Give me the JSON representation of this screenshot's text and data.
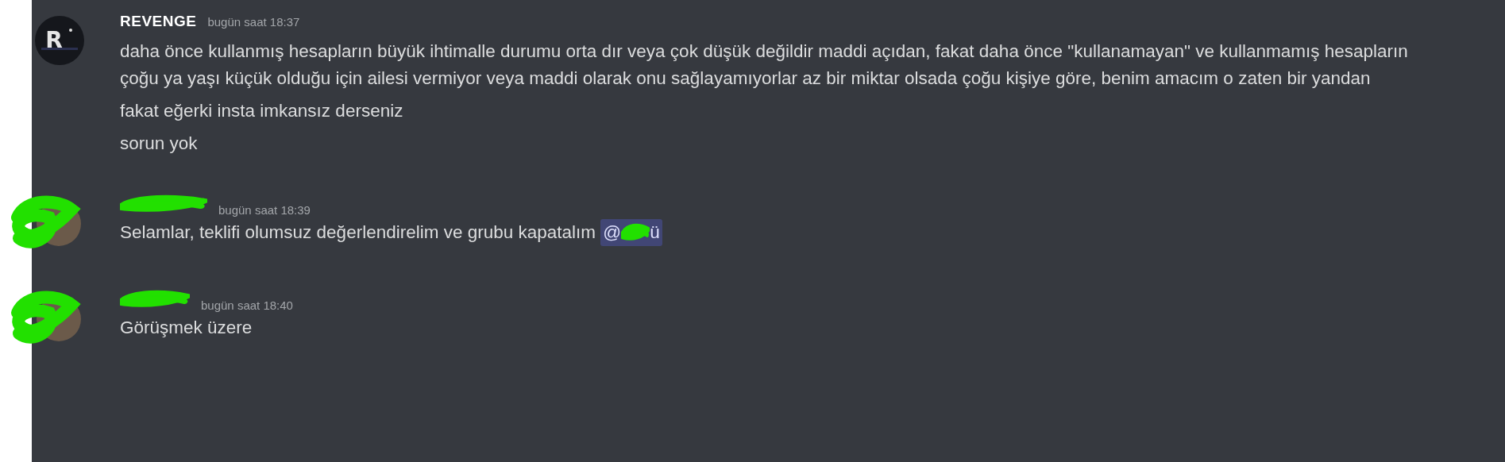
{
  "messages": [
    {
      "author": {
        "name": "REVENGE",
        "redacted": false
      },
      "avatar": {
        "kind": "logo",
        "letter": "R"
      },
      "time": "bugün saat 18:37",
      "lines": [
        "daha önce kullanmış hesapların büyük ihtimalle durumu orta dır veya çok düşük değildir maddi açıdan, fakat daha önce \"kullanamayan\" ve kullanmamış hesapların çoğu ya yaşı küçük olduğu için ailesi vermiyor veya maddi olarak onu sağlayamıyorlar az bir miktar olsada çoğu kişiye göre, benim amacım o zaten bir yandan",
        "fakat eğerki insta imkansız derseniz",
        "sorun yok"
      ]
    },
    {
      "author": {
        "redacted": true
      },
      "avatar": {
        "kind": "redacted"
      },
      "time": "bugün saat 18:39",
      "lines": [
        "Selamlar, teklifi olumsuz değerlendirelim ve grubu kapatalım"
      ],
      "mention": {
        "start": "@",
        "end": "ü"
      }
    },
    {
      "author": {
        "redacted": true
      },
      "avatar": {
        "kind": "redacted"
      },
      "time": "bugün saat 18:40",
      "lines": [
        "Görüşmek üzere"
      ]
    }
  ]
}
